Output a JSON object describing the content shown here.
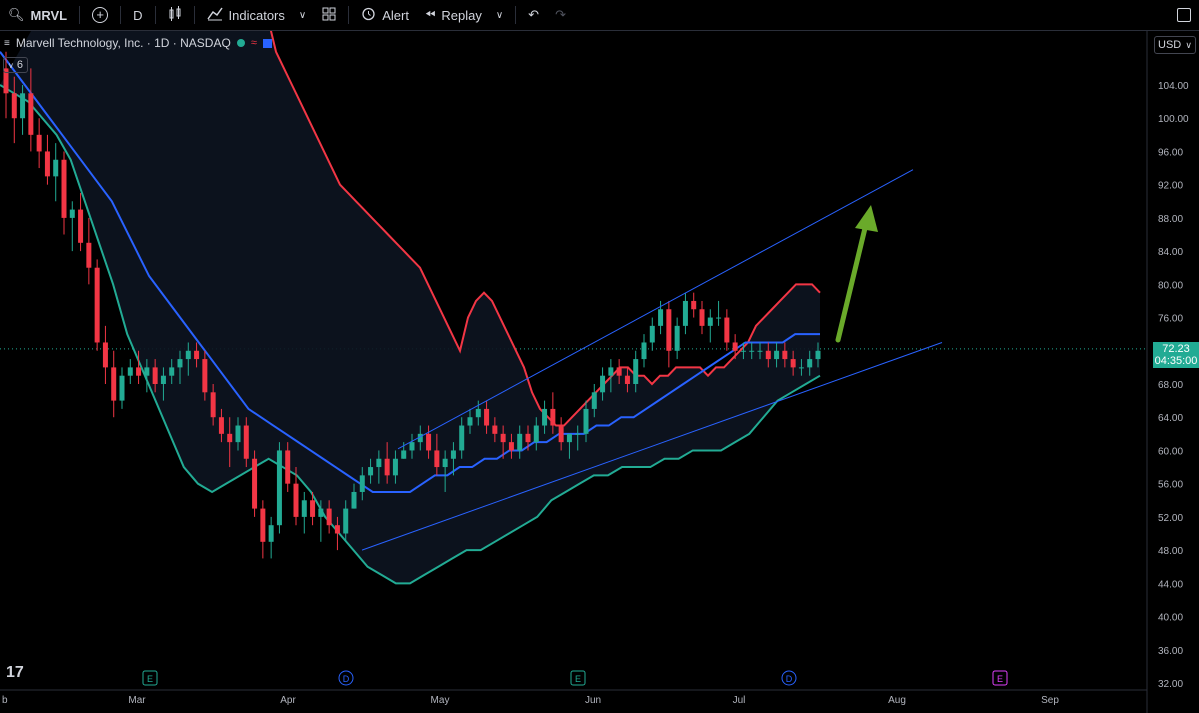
{
  "toolbar": {
    "symbol": "MRVL",
    "interval": "D",
    "indicators_label": "Indicators",
    "alert_label": "Alert",
    "replay_label": "Replay"
  },
  "legend": {
    "title": "Marvell Technology, Inc. · 1D · NASDAQ",
    "indicator_count": "6"
  },
  "price_axis": {
    "currency": "USD",
    "ticks": [
      "104.00",
      "100.00",
      "96.00",
      "92.00",
      "88.00",
      "84.00",
      "80.00",
      "76.00",
      "72.00",
      "68.00",
      "64.00",
      "60.00",
      "56.00",
      "52.00",
      "48.00",
      "44.00",
      "40.00",
      "36.00",
      "32.00"
    ],
    "last_price": "72.23",
    "countdown": "04:35:00"
  },
  "time_axis": {
    "labels": [
      "b",
      "Mar",
      "Apr",
      "May",
      "Jun",
      "Jul",
      "Aug",
      "Sep"
    ]
  },
  "markers": [
    {
      "letter": "E",
      "type": "earnings"
    },
    {
      "letter": "D",
      "type": "dividend"
    },
    {
      "letter": "E",
      "type": "earnings"
    },
    {
      "letter": "D",
      "type": "dividend"
    },
    {
      "letter": "E",
      "type": "earnings"
    }
  ],
  "colors": {
    "up": "#22ab94",
    "down": "#f23645",
    "upper_band": "#f23645",
    "middle_band": "#2962ff",
    "lower_band": "#22ab94",
    "trendline": "#2962ff",
    "arrow": "#6aaa2a",
    "background": "#000000"
  },
  "chart_data": {
    "type": "candlestick",
    "symbol": "MRVL",
    "interval": "1D",
    "ylim": [
      32,
      106
    ],
    "candles": [
      [
        106,
        108,
        100,
        103
      ],
      [
        103,
        105,
        97,
        100
      ],
      [
        100,
        104,
        98,
        103
      ],
      [
        103,
        106,
        96,
        98
      ],
      [
        98,
        100,
        94,
        96
      ],
      [
        96,
        98,
        92,
        93
      ],
      [
        93,
        97,
        90,
        95
      ],
      [
        95,
        96,
        86,
        88
      ],
      [
        88,
        90,
        84,
        89
      ],
      [
        89,
        91,
        84,
        85
      ],
      [
        85,
        88,
        80,
        82
      ],
      [
        82,
        83,
        72,
        73
      ],
      [
        73,
        75,
        68,
        70
      ],
      [
        70,
        72,
        64,
        66
      ],
      [
        66,
        70,
        65,
        69
      ],
      [
        69,
        71,
        68,
        70
      ],
      [
        70,
        72,
        68,
        69
      ],
      [
        69,
        71,
        67,
        70
      ],
      [
        70,
        71,
        67,
        68
      ],
      [
        68,
        70,
        66,
        69
      ],
      [
        69,
        71,
        68,
        70
      ],
      [
        70,
        72,
        68,
        71
      ],
      [
        71,
        73,
        69,
        72
      ],
      [
        72,
        73,
        70,
        71
      ],
      [
        71,
        72,
        66,
        67
      ],
      [
        67,
        68,
        63,
        64
      ],
      [
        64,
        65,
        61,
        62
      ],
      [
        62,
        64,
        58,
        61
      ],
      [
        61,
        64,
        60,
        63
      ],
      [
        63,
        64,
        58,
        59
      ],
      [
        59,
        60,
        52,
        53
      ],
      [
        53,
        54,
        47,
        49
      ],
      [
        49,
        52,
        47,
        51
      ],
      [
        51,
        61,
        50,
        60
      ],
      [
        60,
        61,
        55,
        56
      ],
      [
        56,
        58,
        51,
        52
      ],
      [
        52,
        55,
        50,
        54
      ],
      [
        54,
        55,
        51,
        52
      ],
      [
        52,
        54,
        49,
        53
      ],
      [
        53,
        54,
        50,
        51
      ],
      [
        51,
        52,
        48,
        50
      ],
      [
        50,
        54,
        49,
        53
      ],
      [
        53,
        56,
        53,
        55
      ],
      [
        55,
        58,
        54,
        57
      ],
      [
        57,
        59,
        56,
        58
      ],
      [
        58,
        60,
        56,
        59
      ],
      [
        59,
        61,
        56,
        57
      ],
      [
        57,
        60,
        56,
        59
      ],
      [
        59,
        61,
        59,
        60
      ],
      [
        60,
        62,
        59,
        61
      ],
      [
        61,
        63,
        60,
        62
      ],
      [
        62,
        63,
        59,
        60
      ],
      [
        60,
        62,
        57,
        58
      ],
      [
        58,
        60,
        55,
        59
      ],
      [
        59,
        61,
        57,
        60
      ],
      [
        60,
        64,
        59,
        63
      ],
      [
        63,
        65,
        62,
        64
      ],
      [
        64,
        66,
        63,
        65
      ],
      [
        65,
        66,
        62,
        63
      ],
      [
        63,
        64,
        61,
        62
      ],
      [
        62,
        63,
        59,
        61
      ],
      [
        61,
        62,
        59,
        60
      ],
      [
        60,
        63,
        59,
        62
      ],
      [
        62,
        63,
        60,
        61
      ],
      [
        61,
        64,
        60,
        63
      ],
      [
        63,
        66,
        62,
        65
      ],
      [
        65,
        67,
        62,
        63
      ],
      [
        63,
        64,
        60,
        61
      ],
      [
        61,
        62,
        59,
        62
      ],
      [
        62,
        63,
        60,
        62
      ],
      [
        62,
        66,
        61,
        65
      ],
      [
        65,
        68,
        64,
        67
      ],
      [
        67,
        70,
        66,
        69
      ],
      [
        69,
        71,
        67,
        70
      ],
      [
        70,
        71,
        68,
        69
      ],
      [
        69,
        70,
        67,
        68
      ],
      [
        68,
        72,
        67,
        71
      ],
      [
        71,
        74,
        70,
        73
      ],
      [
        73,
        76,
        72,
        75
      ],
      [
        75,
        78,
        74,
        77
      ],
      [
        77,
        78,
        70,
        72
      ],
      [
        72,
        76,
        71,
        75
      ],
      [
        75,
        79,
        74,
        78
      ],
      [
        78,
        79,
        76,
        77
      ],
      [
        77,
        78,
        74,
        75
      ],
      [
        75,
        77,
        73,
        76
      ],
      [
        76,
        78,
        75,
        76
      ],
      [
        76,
        77,
        72,
        73
      ],
      [
        73,
        74,
        71,
        72
      ],
      [
        72,
        73,
        71,
        72
      ],
      [
        72,
        73,
        71,
        72
      ],
      [
        72,
        73,
        71,
        72
      ],
      [
        72,
        73,
        70,
        71
      ],
      [
        71,
        73,
        70,
        72
      ],
      [
        72,
        73,
        70,
        71
      ],
      [
        71,
        72,
        69,
        70
      ],
      [
        70,
        71,
        69,
        70
      ],
      [
        70,
        72,
        69,
        71
      ],
      [
        71,
        73,
        70,
        72
      ]
    ],
    "bollinger_upper": [
      150,
      140,
      132,
      125,
      120,
      115,
      112,
      108,
      106,
      104,
      102,
      100,
      98,
      96,
      94,
      92,
      91,
      90,
      89,
      88,
      87,
      86,
      85,
      84,
      83,
      82,
      80,
      78,
      76,
      74,
      72,
      76,
      78,
      79,
      78,
      76,
      74,
      72,
      70,
      67,
      65,
      64,
      63,
      63,
      64,
      65,
      66,
      67,
      68,
      69,
      70,
      70,
      69,
      69,
      68,
      69,
      69,
      70,
      70,
      70,
      70,
      69,
      70,
      70,
      71,
      72,
      73,
      75,
      76,
      77,
      78,
      79,
      80,
      80,
      80,
      79
    ],
    "bollinger_middle": [
      108,
      106,
      104,
      102,
      100,
      98,
      96,
      94,
      92,
      90,
      87,
      84,
      81,
      79,
      77,
      75,
      73,
      71,
      69,
      67,
      65,
      64,
      63,
      62,
      61,
      60,
      59,
      58,
      57,
      56,
      55,
      55,
      55,
      55,
      56,
      57,
      57,
      58,
      58,
      59,
      59,
      60,
      60,
      61,
      61,
      62,
      62,
      62,
      63,
      63,
      64,
      64,
      65,
      66,
      67,
      68,
      69,
      70,
      71,
      72,
      73,
      73,
      73,
      73,
      74,
      74,
      74
    ],
    "bollinger_lower": [
      104,
      103,
      102,
      100,
      98,
      95,
      90,
      85,
      80,
      74,
      70,
      66,
      62,
      58,
      56,
      55,
      56,
      57,
      58,
      59,
      58,
      57,
      55,
      52,
      50,
      48,
      46,
      45,
      44,
      44,
      45,
      46,
      47,
      48,
      48,
      49,
      50,
      51,
      52,
      54,
      55,
      56,
      57,
      57,
      58,
      58,
      58,
      59,
      59,
      60,
      60,
      60,
      61,
      62,
      64,
      66,
      67,
      68,
      69
    ]
  }
}
